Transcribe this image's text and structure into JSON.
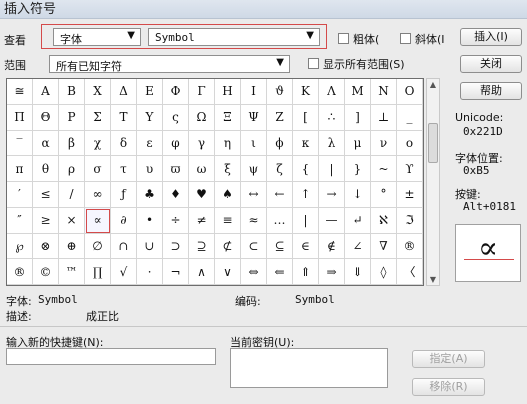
{
  "window": {
    "title": "插入符号"
  },
  "toolbar": {
    "view_label": "查看",
    "font_type_value": "字体",
    "font_name_value": "Symbol",
    "bold_label": "粗体(",
    "italic_label": "斜体(I"
  },
  "range": {
    "label": "范围",
    "value": "所有已知字符",
    "show_all_label": "显示所有范围(S)"
  },
  "buttons": {
    "insert": "插入(I)",
    "close": "关闭",
    "help": "帮助",
    "assign": "指定(A)",
    "remove": "移除(R)"
  },
  "info": {
    "unicode_label": "Unicode:",
    "unicode_value": "0x221D",
    "font_pos_label": "字体位置:",
    "font_pos_value": "0xB5",
    "keystroke_label": "按键:",
    "keystroke_value": "Alt+0181"
  },
  "preview": {
    "symbol": "∝"
  },
  "status": {
    "font_label": "字体:",
    "font_value": "Symbol",
    "encoding_label": "编码:",
    "encoding_value": "Symbol",
    "desc_label": "描述:",
    "desc_value": "成正比"
  },
  "shortcut": {
    "new_label": "输入新的快捷键(N):",
    "current_label": "当前密钥(U):"
  },
  "chars": [
    [
      "≅",
      "A",
      "B",
      "X",
      "Δ",
      "E",
      "Φ",
      "Γ",
      "H",
      "I",
      "ϑ",
      "K",
      "Λ",
      "M",
      "N",
      "O"
    ],
    [
      "Π",
      "Θ",
      "P",
      "Σ",
      "T",
      "Y",
      "ς",
      "Ω",
      "Ξ",
      "Ψ",
      "Z",
      "[",
      "∴",
      "]",
      "⊥",
      "_"
    ],
    [
      "‾",
      "α",
      "β",
      "χ",
      "δ",
      "ε",
      "φ",
      "γ",
      "η",
      "ι",
      "ϕ",
      "κ",
      "λ",
      "μ",
      "ν",
      "ο"
    ],
    [
      "π",
      "θ",
      "ρ",
      "σ",
      "τ",
      "υ",
      "ϖ",
      "ω",
      "ξ",
      "ψ",
      "ζ",
      "{",
      "|",
      "}",
      "~",
      "ϒ"
    ],
    [
      "′",
      "≤",
      "/",
      "∞",
      "ƒ",
      "♣",
      "♦",
      "♥",
      "♠",
      "↔",
      "←",
      "↑",
      "→",
      "↓",
      "°",
      "±"
    ],
    [
      "″",
      "≥",
      "×",
      "∝",
      "∂",
      "•",
      "÷",
      "≠",
      "≡",
      "≈",
      "…",
      "|",
      "—",
      "↵",
      "ℵ",
      "ℑ"
    ],
    [
      "℘",
      "⊗",
      "⊕",
      "∅",
      "∩",
      "∪",
      "⊃",
      "⊇",
      "⊄",
      "⊂",
      "⊆",
      "∈",
      "∉",
      "∠",
      "∇",
      "®"
    ],
    [
      "®",
      "©",
      "™",
      "∏",
      "√",
      "⋅",
      "¬",
      "∧",
      "∨",
      "⇔",
      "⇐",
      "⇑",
      "⇒",
      "⇓",
      "◊",
      "〈"
    ]
  ]
}
